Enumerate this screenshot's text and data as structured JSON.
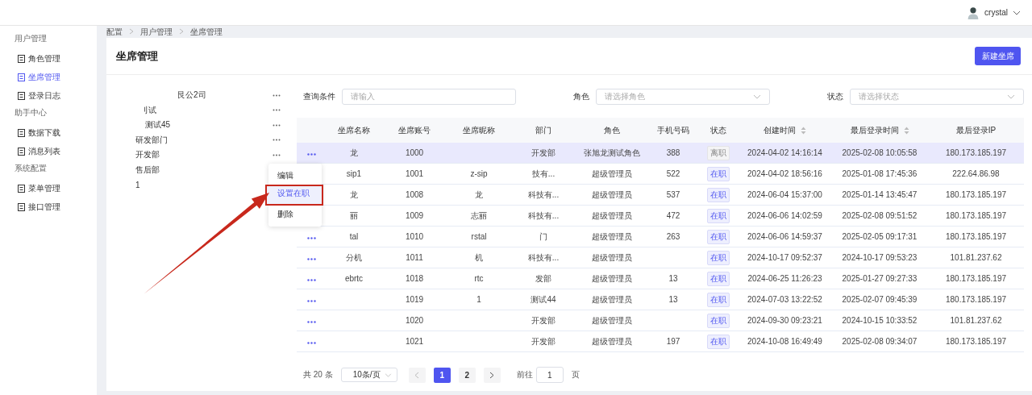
{
  "topbar": {
    "user": "crystal"
  },
  "sidebar": {
    "groups": [
      {
        "title": "用户管理",
        "items": [
          {
            "label": "角色管理",
            "selected": false
          },
          {
            "label": "坐席管理",
            "selected": true
          },
          {
            "label": "登录日志",
            "selected": false
          }
        ]
      },
      {
        "title": "助手中心",
        "items": [
          {
            "label": "数据下载",
            "selected": false
          },
          {
            "label": "消息列表",
            "selected": false
          }
        ]
      },
      {
        "title": "系统配置",
        "items": [
          {
            "label": "菜单管理",
            "selected": false
          },
          {
            "label": "接口管理",
            "selected": false
          }
        ]
      }
    ]
  },
  "breadcrumb": [
    "配置",
    "用户管理",
    "坐席管理"
  ],
  "page": {
    "title": "坐席管理",
    "new_button": "新建坐席"
  },
  "tree": [
    {
      "label": "艮公2司",
      "children": [
        {
          "label": "刂试",
          "children": [
            {
              "label": "测试45"
            }
          ]
        }
      ]
    },
    {
      "label": "研发部门"
    },
    {
      "label": "开发部"
    },
    {
      "label": "售后部"
    },
    {
      "label": "1"
    }
  ],
  "context_menu": [
    {
      "label": "编辑",
      "selected": false
    },
    {
      "label": "设置在职",
      "selected": true
    },
    {
      "label": "删除",
      "selected": false
    }
  ],
  "filters": [
    {
      "label": "查询条件",
      "kind": "input",
      "placeholder": "请输入"
    },
    {
      "label": "角色",
      "kind": "select",
      "placeholder": "请选择角色"
    },
    {
      "label": "状态",
      "kind": "select",
      "placeholder": "请选择状态"
    }
  ],
  "table": {
    "columns": [
      {
        "label": "坐席名称",
        "sortable": false
      },
      {
        "label": "坐席账号",
        "sortable": false
      },
      {
        "label": "坐席昵称",
        "sortable": false
      },
      {
        "label": "部门",
        "sortable": false
      },
      {
        "label": "角色",
        "sortable": false
      },
      {
        "label": "手机号码",
        "sortable": false
      },
      {
        "label": "状态",
        "sortable": false
      },
      {
        "label": "创建时间",
        "sortable": true
      },
      {
        "label": "最后登录时间",
        "sortable": true
      },
      {
        "label": "最后登录IP",
        "sortable": false
      }
    ],
    "rows": [
      {
        "selected": true,
        "name": "龙",
        "account": "1000",
        "nickname": "",
        "dept": "开发部",
        "role": "张旭龙测试角色",
        "phone": "388",
        "status": {
          "text": "离职",
          "active": false
        },
        "created": "2024-04-02 14:16:14",
        "last_login": "2025-02-08 10:05:58",
        "ip": "180.173.185.197"
      },
      {
        "selected": false,
        "name": "sip1",
        "account": "1001",
        "nickname": "z-sip",
        "dept": "技有...",
        "role": "超级管理员",
        "phone": "522",
        "status": {
          "text": "在职",
          "active": true
        },
        "created": "2024-04-02 18:56:16",
        "last_login": "2025-01-08 17:45:36",
        "ip": "222.64.86.98"
      },
      {
        "selected": false,
        "name": "龙",
        "account": "1008",
        "nickname": "龙",
        "dept": "科技有...",
        "role": "超级管理员",
        "phone": "537",
        "status": {
          "text": "在职",
          "active": true
        },
        "created": "2024-06-04 15:37:00",
        "last_login": "2025-01-14 13:45:47",
        "ip": "180.173.185.197"
      },
      {
        "selected": false,
        "name": "丽",
        "account": "1009",
        "nickname": "志丽",
        "dept": "科技有...",
        "role": "超级管理员",
        "phone": "472",
        "status": {
          "text": "在职",
          "active": true
        },
        "created": "2024-06-06 14:02:59",
        "last_login": "2025-02-08 09:51:52",
        "ip": "180.173.185.197"
      },
      {
        "selected": false,
        "name": "tal",
        "account": "1010",
        "nickname": "rstal",
        "dept": "门",
        "role": "超级管理员",
        "phone": "263",
        "status": {
          "text": "在职",
          "active": true
        },
        "created": "2024-06-06 14:59:37",
        "last_login": "2025-02-05 09:17:31",
        "ip": "180.173.185.197"
      },
      {
        "selected": false,
        "name": "分机",
        "account": "1011",
        "nickname": "机",
        "dept": "科技有...",
        "role": "超级管理员",
        "phone": "",
        "status": {
          "text": "在职",
          "active": true
        },
        "created": "2024-10-17 09:52:37",
        "last_login": "2024-10-17 09:53:23",
        "ip": "101.81.237.62"
      },
      {
        "selected": false,
        "name": "ebrtc",
        "account": "1018",
        "nickname": "rtc",
        "dept": "发部",
        "role": "超级管理员",
        "phone": "13",
        "status": {
          "text": "在职",
          "active": true
        },
        "created": "2024-06-25 11:26:23",
        "last_login": "2025-01-27 09:27:33",
        "ip": "180.173.185.197"
      },
      {
        "selected": false,
        "name": "",
        "account": "1019",
        "nickname": "1",
        "dept": "测试44",
        "role": "超级管理员",
        "phone": "13",
        "status": {
          "text": "在职",
          "active": true
        },
        "created": "2024-07-03 13:22:52",
        "last_login": "2025-02-07 09:45:39",
        "ip": "180.173.185.197"
      },
      {
        "selected": false,
        "name": "",
        "account": "1020",
        "nickname": "",
        "dept": "开发部",
        "role": "超级管理员",
        "phone": "",
        "status": {
          "text": "在职",
          "active": true
        },
        "created": "2024-09-30 09:23:21",
        "last_login": "2024-10-15 10:33:52",
        "ip": "101.81.237.62"
      },
      {
        "selected": false,
        "name": "",
        "account": "1021",
        "nickname": "",
        "dept": "开发部",
        "role": "超级管理员",
        "phone": "197",
        "status": {
          "text": "在职",
          "active": true
        },
        "created": "2024-10-08 16:49:49",
        "last_login": "2025-02-08 09:34:07",
        "ip": "180.173.185.197"
      }
    ]
  },
  "pagination": {
    "total": "共 20 条",
    "page_size": "10条/页",
    "pages": [
      {
        "label": "1",
        "selected": true
      },
      {
        "label": "2",
        "selected": false
      }
    ],
    "goto_label": "前往",
    "goto_value": "1",
    "goto_suffix": "页"
  }
}
